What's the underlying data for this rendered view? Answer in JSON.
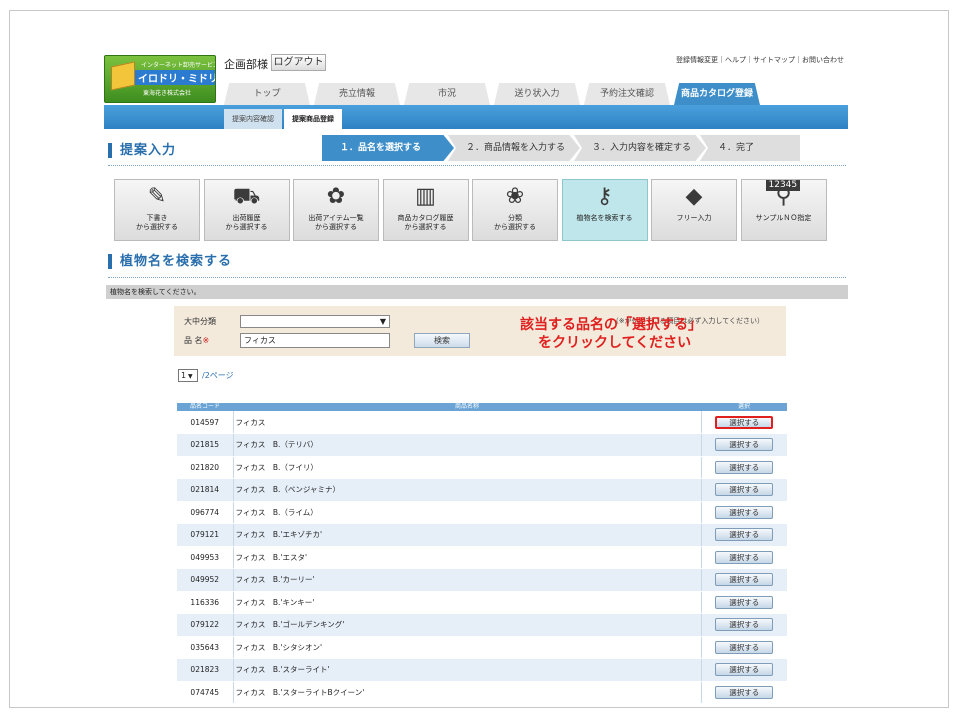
{
  "header": {
    "logo": {
      "line1": "インターネット卸売サービス",
      "line2": "イロドリ・ミドリ",
      "line3": "東海花き株式会社"
    },
    "user_name": "企画部様",
    "logout_label": "ログアウト",
    "top_links": "登録情報変更｜ヘルプ｜サイトマップ｜お問い合わせ"
  },
  "main_tabs": [
    {
      "label": "トップ",
      "active": false
    },
    {
      "label": "売立情報",
      "active": false
    },
    {
      "label": "市況",
      "active": false
    },
    {
      "label": "送り状入力",
      "active": false
    },
    {
      "label": "予約注文確認",
      "active": false
    },
    {
      "label": "商品カタログ登録",
      "active": true
    }
  ],
  "sub_tabs": [
    {
      "label": "提案内容確認",
      "active": false
    },
    {
      "label": "提案商品登録",
      "active": true
    }
  ],
  "proposal_section": {
    "title": "提案入力",
    "steps": [
      "１．品名を選択する",
      "２．商品情報を入力する",
      "３．入力内容を確定する",
      "４．完了"
    ]
  },
  "methods": [
    {
      "label": "下書き\nから選択する",
      "icon": "pencil-icon"
    },
    {
      "label": "出荷履歴\nから選択する",
      "icon": "truck-icon"
    },
    {
      "label": "出荷アイテム一覧\nから選択する",
      "icon": "flower-cart-icon"
    },
    {
      "label": "商品カタログ履歴\nから選択する",
      "icon": "book-icon"
    },
    {
      "label": "分類\nから選択する",
      "icon": "flower-icon"
    },
    {
      "label": "植物名を検索する",
      "icon": "key-icon"
    },
    {
      "label": "フリー入力",
      "icon": "tag-icon"
    },
    {
      "label": "サンプルＮＯ指定",
      "icon": "sample-number-icon",
      "badge": "12345"
    }
  ],
  "search_section": {
    "title": "植物名を検索する",
    "instruction": "植物名を検索してください。",
    "category_label": "大中分類",
    "name_label": "品 名",
    "required_mark": "※",
    "name_value": "フィカス",
    "search_button": "検索",
    "note": "（※が付いている項目は必ず入力してください）"
  },
  "pager": {
    "selected": "1",
    "total_label": "/2ページ"
  },
  "callout": {
    "line1": "該当する品名の「選択する」",
    "line2": "をクリックしてください"
  },
  "table": {
    "headers": [
      "品名コード",
      "商品名称",
      "選択"
    ],
    "select_label": "選択する",
    "rows": [
      {
        "code": "014597",
        "name": "フィカス"
      },
      {
        "code": "021815",
        "name": "フィカス　B.（テリバ）"
      },
      {
        "code": "021820",
        "name": "フィカス　B.（フイリ）"
      },
      {
        "code": "021814",
        "name": "フィカス　B.（ベンジャミナ）"
      },
      {
        "code": "096774",
        "name": "フィカス　B.（ライム）"
      },
      {
        "code": "079121",
        "name": "フィカス　B.'エキゾチカ'"
      },
      {
        "code": "049953",
        "name": "フィカス　B.'エスタ'"
      },
      {
        "code": "049952",
        "name": "フィカス　B.'カーリー'"
      },
      {
        "code": "116336",
        "name": "フィカス　B.'キンキー'"
      },
      {
        "code": "079122",
        "name": "フィカス　B.'ゴールデンキング'"
      },
      {
        "code": "035643",
        "name": "フィカス　B.'シタシオン'"
      },
      {
        "code": "021823",
        "name": "フィカス　B.'スターライト'"
      },
      {
        "code": "074745",
        "name": "フィカス　B.'スターライトBクイーン'"
      }
    ]
  },
  "colors": {
    "accent_blue": "#3d8ec9",
    "callout_red": "#e0201e",
    "active_method": "#bfe6ea"
  }
}
